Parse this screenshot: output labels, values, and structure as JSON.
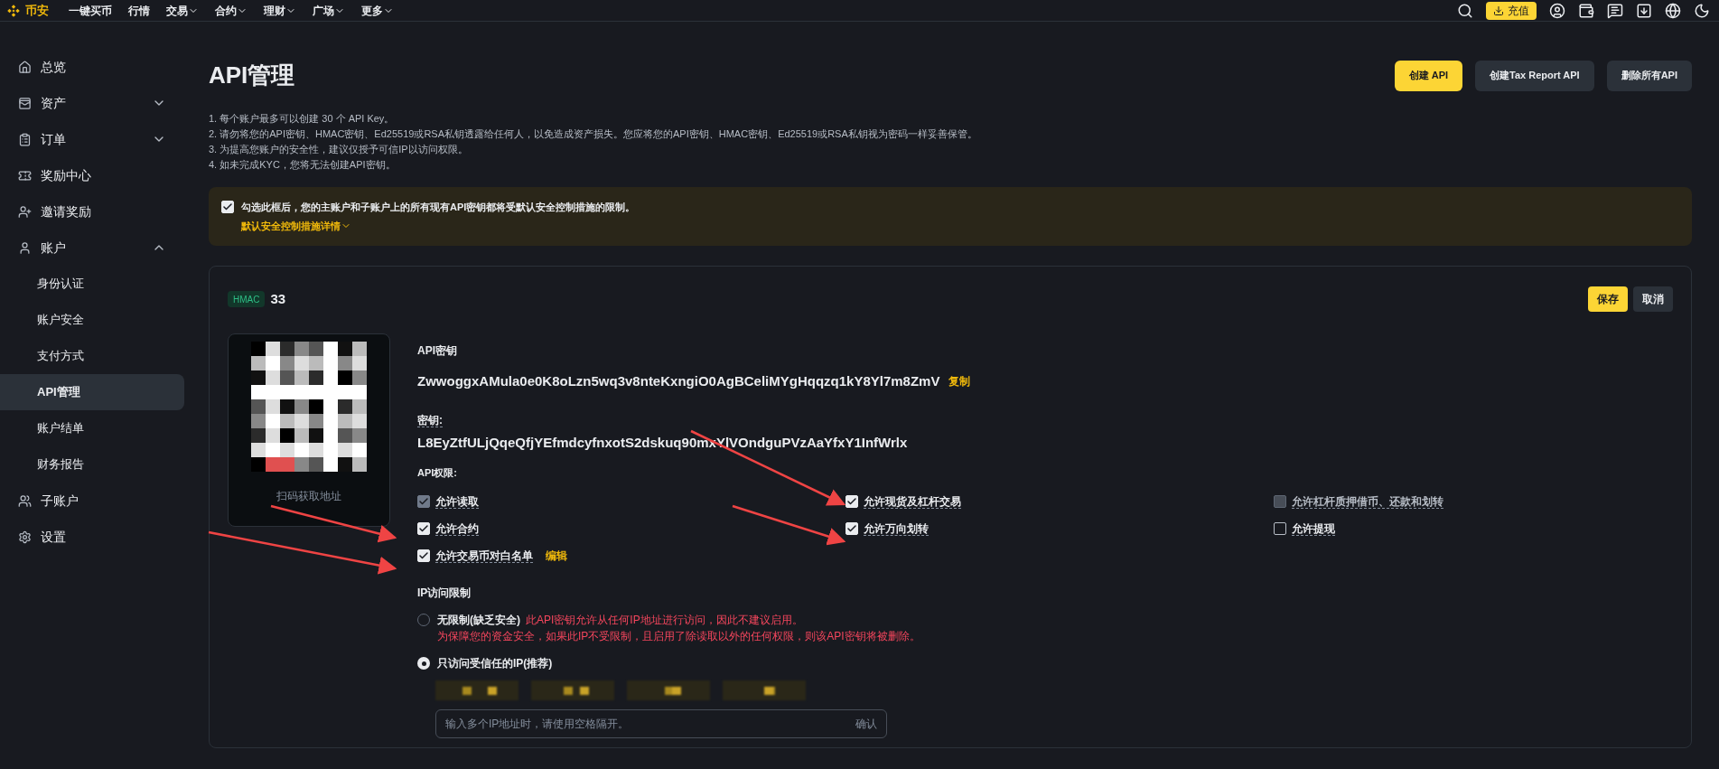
{
  "topbar": {
    "brand": "币安",
    "nav": [
      {
        "label": "一键买币",
        "dropdown": false
      },
      {
        "label": "行情",
        "dropdown": false
      },
      {
        "label": "交易",
        "dropdown": true
      },
      {
        "label": "合约",
        "dropdown": true
      },
      {
        "label": "理财",
        "dropdown": true
      },
      {
        "label": "广场",
        "dropdown": true
      },
      {
        "label": "更多",
        "dropdown": true
      }
    ],
    "deposit_button": "充值"
  },
  "sidebar": {
    "items": [
      {
        "label": "总览",
        "selected": false
      },
      {
        "label": "资产",
        "selected": false,
        "expanded": false
      },
      {
        "label": "订单",
        "selected": false,
        "expanded": false
      },
      {
        "label": "奖励中心",
        "selected": false
      },
      {
        "label": "邀请奖励",
        "selected": false
      },
      {
        "label": "账户",
        "selected": false,
        "expanded": true,
        "children": [
          {
            "label": "身份认证",
            "selected": false
          },
          {
            "label": "账户安全",
            "selected": false
          },
          {
            "label": "支付方式",
            "selected": false
          },
          {
            "label": "API管理",
            "selected": true
          },
          {
            "label": "账户结单",
            "selected": false
          },
          {
            "label": "财务报告",
            "selected": false
          }
        ]
      },
      {
        "label": "子账户",
        "selected": false
      },
      {
        "label": "设置",
        "selected": false
      }
    ]
  },
  "page": {
    "title": "API管理",
    "actions": [
      {
        "label": "创建 API",
        "primary": true
      },
      {
        "label": "创建Tax Report API",
        "primary": false
      },
      {
        "label": "删除所有API",
        "primary": false
      }
    ],
    "notes": [
      "1. 每个账户最多可以创建 30 个 API Key。",
      "2. 请勿将您的API密钥、HMAC密钥、Ed25519或RSA私钥透露给任何人，以免造成资产损失。您应将您的API密钥、HMAC密钥、Ed25519或RSA私钥视为密码一样妥善保管。",
      "3. 为提高您账户的安全性，建议仅授予可信IP以访问权限。",
      "4. 如未完成KYC，您将无法创建API密钥。"
    ],
    "security_notice": {
      "checked": true,
      "text": "勾选此框后，您的主账户和子账户上的所有现有API密钥都将受默认安全控制措施的限制。",
      "link": "默认安全控制措施详情"
    }
  },
  "api_card": {
    "type_badge": "HMAC",
    "name": "33",
    "save_button": "保存",
    "cancel_button": "取消",
    "qr_caption": "扫码获取地址",
    "api_key_label": "API密钥",
    "api_key": "ZwwoggxAMula0e0K8oLzn5wq3v8nteKxngiO0AgBCeliMYgHqqzq1kY8Yl7m8ZmV",
    "copy_link": "复制",
    "secret_label": "密钥:",
    "secret": "L8EyZtfULjQqeQfjYEfmdcyfnxotS2dskuq90mxYlVOndguPVzAaYfxY1InfWrlx",
    "permissions_label": "API权限:",
    "permissions": [
      {
        "label": "允许读取",
        "checked": true,
        "disabled": true
      },
      {
        "label": "允许现货及杠杆交易",
        "checked": true,
        "disabled": false
      },
      {
        "label": "允许杠杆质押借币、还款和划转",
        "checked": false,
        "disabled": true
      },
      {
        "label": "允许合约",
        "checked": true,
        "disabled": false
      },
      {
        "label": "允许万向划转",
        "checked": true,
        "disabled": false
      },
      {
        "label": "允许提现",
        "checked": false,
        "disabled": false
      },
      {
        "label": "允许交易币对白名单",
        "checked": true,
        "disabled": false,
        "edit_link": "编辑"
      }
    ],
    "ip_label": "IP访问限制",
    "ip_options": [
      {
        "label": "无限制(缺乏安全)",
        "selected": false,
        "warning": "此API密钥允许从任何IP地址进行访问，因此不建议启用。",
        "warning_2": "为保障您的资金安全，如果此IP不受限制，且启用了除读取以外的任何权限，则该API密钥将被删除。"
      },
      {
        "label": "只访问受信任的IP(推荐)",
        "selected": true
      }
    ],
    "ip_input": {
      "placeholder": "输入多个IP地址时，请使用空格隔开。",
      "confirm": "确认"
    }
  }
}
